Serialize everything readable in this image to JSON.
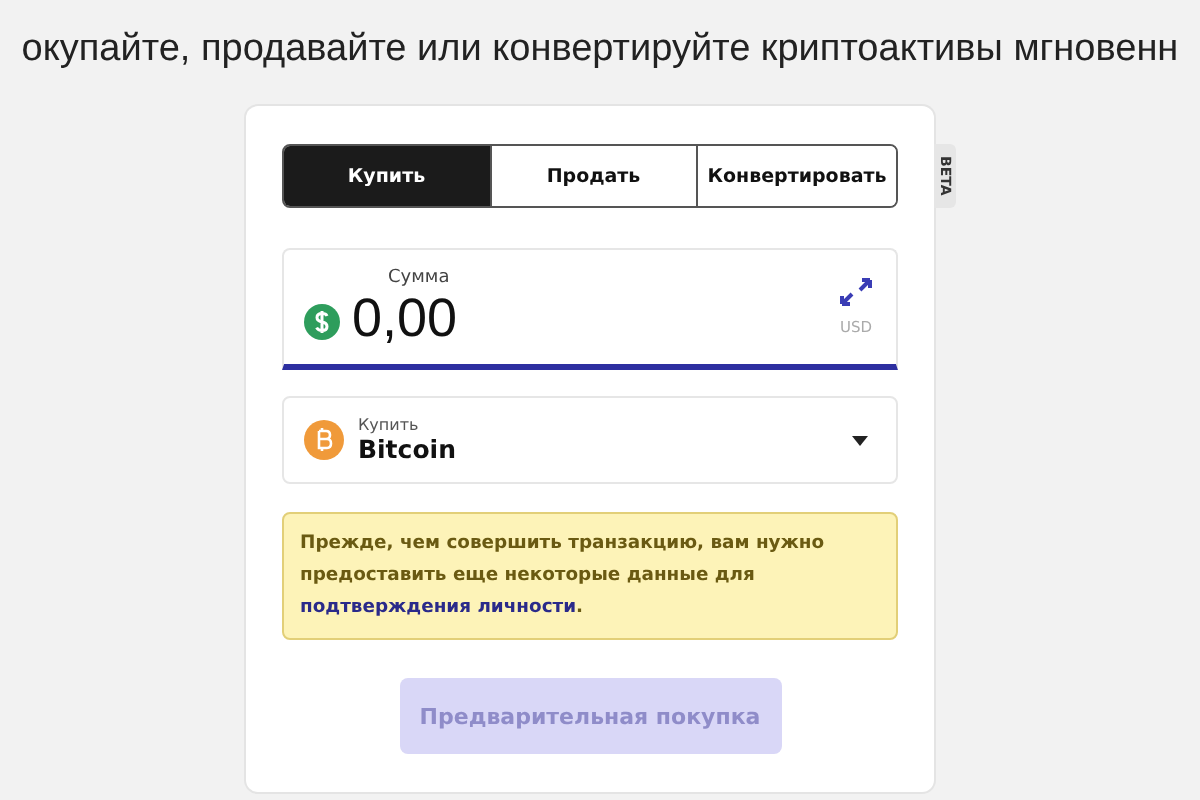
{
  "headline": "окупайте, продавайте или конвертируйте криптоактивы мгновенн",
  "tabs": [
    {
      "label": "Купить",
      "selected": true
    },
    {
      "label": "Продать",
      "selected": false
    },
    {
      "label": "Конвертировать",
      "selected": false
    }
  ],
  "beta_tag": "BETA",
  "amount": {
    "label": "Сумма",
    "value": "0,00",
    "currency": "USD"
  },
  "asset": {
    "label": "Купить",
    "value": "Bitcoin"
  },
  "notice": {
    "text": "Прежде, чем совершить транзакцию, вам нужно предоставить еще некоторые данные для ",
    "link": "подтверждения личности",
    "end": "."
  },
  "submit": {
    "label": "Предварительная покупка",
    "disabled": true
  }
}
